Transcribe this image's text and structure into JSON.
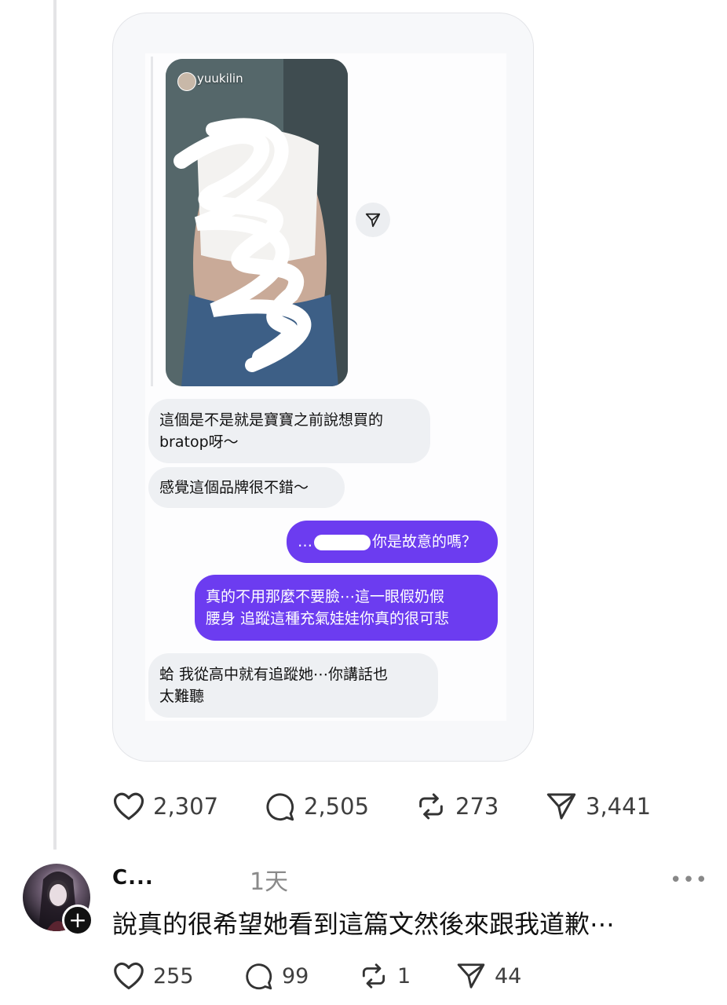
{
  "story": {
    "username": "yuukilin"
  },
  "messages": [
    {
      "side": "in",
      "line1": "這個是不是就是寶寶之前說想買的",
      "line2": "bratop呀～"
    },
    {
      "side": "in",
      "line1": "感覺這個品牌很不錯～"
    },
    {
      "side": "out",
      "prefix": "…",
      "suffix": "你是故意的嗎？"
    },
    {
      "side": "out",
      "line1": "真的不用那麼不要臉⋯這一眼假奶假",
      "line2": "腰身 追蹤這種充氣娃娃你真的很可悲"
    },
    {
      "side": "in",
      "line1": "蛤 我從高中就有追蹤她⋯你講話也",
      "line2": "太難聽"
    }
  ],
  "post_actions": {
    "likes": "2,307",
    "comments": "2,505",
    "reposts": "273",
    "shares": "3,441"
  },
  "comment": {
    "username": "C...",
    "time": "1天",
    "more_label": "•••",
    "follow_label": "+",
    "text": "說真的很希望她看到這篇文然後來跟我道歉⋯",
    "actions": {
      "likes": "255",
      "comments": "99",
      "reposts": "1",
      "shares": "44"
    }
  },
  "icons": [
    "heart-icon",
    "comment-icon",
    "repost-icon",
    "share-icon",
    "send-icon"
  ],
  "colors": {
    "outgoing_bubble": "#6c3cf0",
    "incoming_bubble": "#eef0f3"
  }
}
